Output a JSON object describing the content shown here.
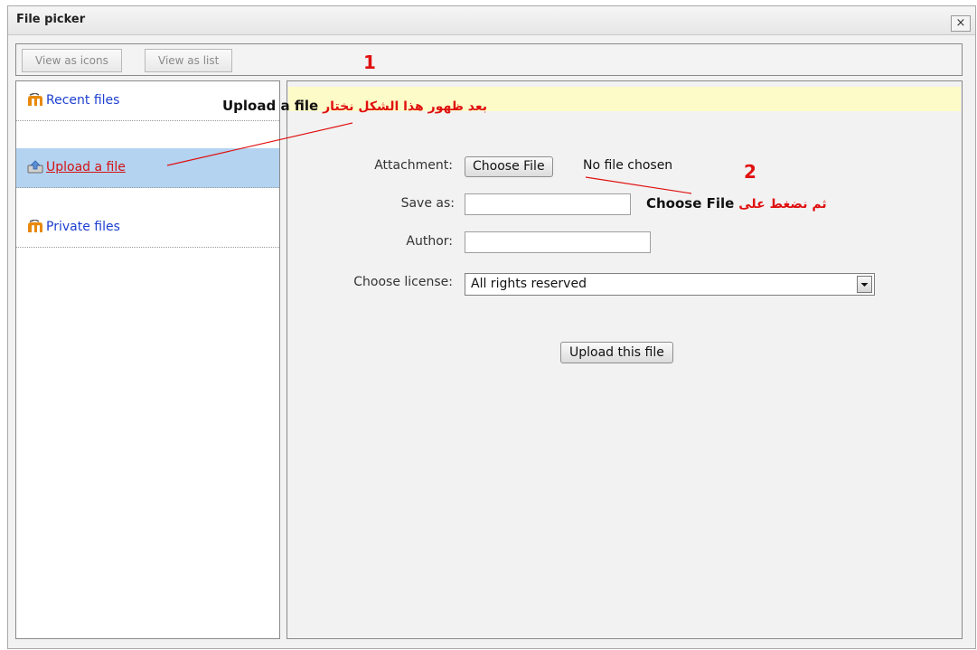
{
  "dialog": {
    "title": "File picker",
    "close_label": "×"
  },
  "toolbar": {
    "view_icons": "View as icons",
    "view_list": "View as list"
  },
  "sidebar": {
    "items": [
      {
        "label": "Recent files"
      },
      {
        "label": "Upload a file"
      },
      {
        "label": "Private files"
      }
    ]
  },
  "form": {
    "attachment_label": "Attachment:",
    "choose_file_button": "Choose File",
    "no_file_text": "No file chosen",
    "save_as_label": "Save as:",
    "save_as_value": "",
    "author_label": "Author:",
    "author_value": "",
    "license_label": "Choose license:",
    "license_value": "All rights reserved",
    "upload_button": "Upload this file"
  },
  "annotations": {
    "step1_number": "1",
    "step1_ar": "بعد ظهور هذا الشكل نختار",
    "step1_en": "Upload a file",
    "step2_number": "2",
    "step2_ar": "ثم نضغط على",
    "step2_en": "Choose File",
    "color": "#e01010"
  }
}
